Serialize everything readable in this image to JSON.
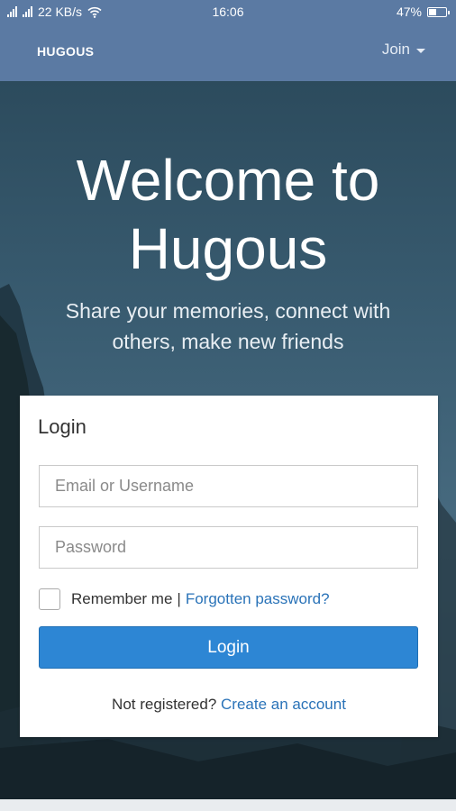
{
  "status_bar": {
    "network_speed": "22 KB/s",
    "time": "16:06",
    "battery": "47%",
    "battery_level": 0.47
  },
  "nav": {
    "brand": "HUGOUS",
    "join_label": "Join"
  },
  "hero": {
    "headline_line1": "Welcome to",
    "headline_line2": "Hugous",
    "tagline": "Share your memories, connect with others, make new friends"
  },
  "login_card": {
    "title": "Login",
    "email_placeholder": "Email or Username",
    "password_placeholder": "Password",
    "remember_label": "Remember me",
    "separator": "|",
    "forgot_link": "Forgotten password?",
    "login_button": "Login",
    "not_registered": "Not registered?",
    "create_account_link": "Create an account"
  },
  "colors": {
    "header_bg": "#5b7aa3",
    "primary_button": "#2d86d4",
    "link": "#2a73b8"
  }
}
